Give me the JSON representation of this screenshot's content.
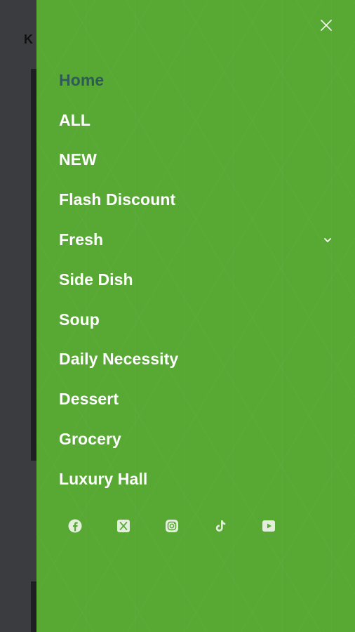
{
  "menu": {
    "items": [
      {
        "label": "Home",
        "active": true,
        "has_submenu": false
      },
      {
        "label": "ALL",
        "active": false,
        "has_submenu": false
      },
      {
        "label": "NEW",
        "active": false,
        "has_submenu": false
      },
      {
        "label": "Flash Discount",
        "active": false,
        "has_submenu": false
      },
      {
        "label": "Fresh",
        "active": false,
        "has_submenu": true
      },
      {
        "label": "Side Dish",
        "active": false,
        "has_submenu": false
      },
      {
        "label": "Soup",
        "active": false,
        "has_submenu": false
      },
      {
        "label": "Daily Necessity",
        "active": false,
        "has_submenu": false
      },
      {
        "label": "Dessert",
        "active": false,
        "has_submenu": false
      },
      {
        "label": "Grocery",
        "active": false,
        "has_submenu": false
      },
      {
        "label": "Luxury Hall",
        "active": false,
        "has_submenu": false
      }
    ]
  },
  "social": [
    "facebook-icon",
    "x-icon",
    "instagram-icon",
    "tiktok-icon",
    "youtube-icon"
  ],
  "colors": {
    "drawer_bg": "#58a834",
    "active_text": "#2e5b55",
    "text": "#ffffff",
    "icon": "#e3efdc",
    "backdrop": "#3a3c40"
  }
}
